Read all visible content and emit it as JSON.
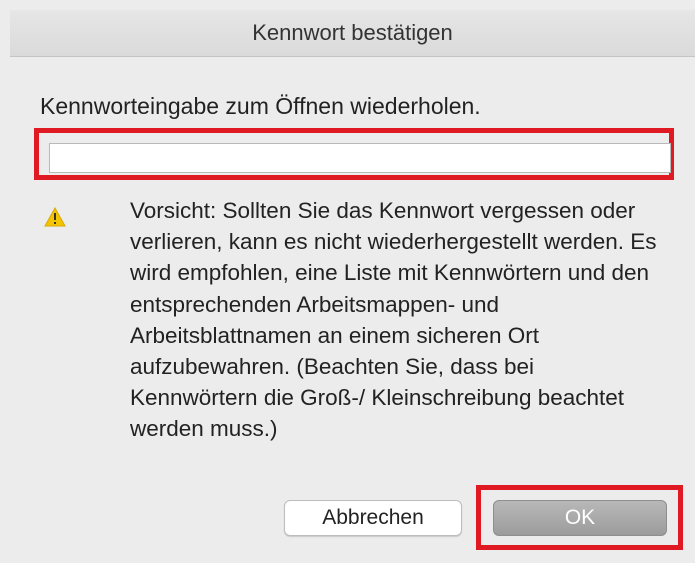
{
  "dialog": {
    "title": "Kennwort bestätigen",
    "prompt": "Kennworteingabe zum Öffnen wiederholen.",
    "password_field": {
      "value": "",
      "placeholder": ""
    },
    "warning": {
      "icon": "warning-icon",
      "text": "Vorsicht: Sollten Sie das Kennwort vergessen oder verlieren, kann es nicht wiederhergestellt werden. Es wird empfohlen, eine Liste mit Kennwörtern und den entsprechenden Arbeitsmappen- und Arbeitsblattnamen an einem sicheren Ort aufzubewahren. (Beachten Sie, dass bei Kennwörtern die Groß-/ Kleinschreibung beachtet werden muss.)"
    },
    "buttons": {
      "cancel_label": "Abbrechen",
      "ok_label": "OK"
    },
    "colors": {
      "highlight": "#e01a22",
      "warning_yellow": "#f5c400"
    }
  }
}
